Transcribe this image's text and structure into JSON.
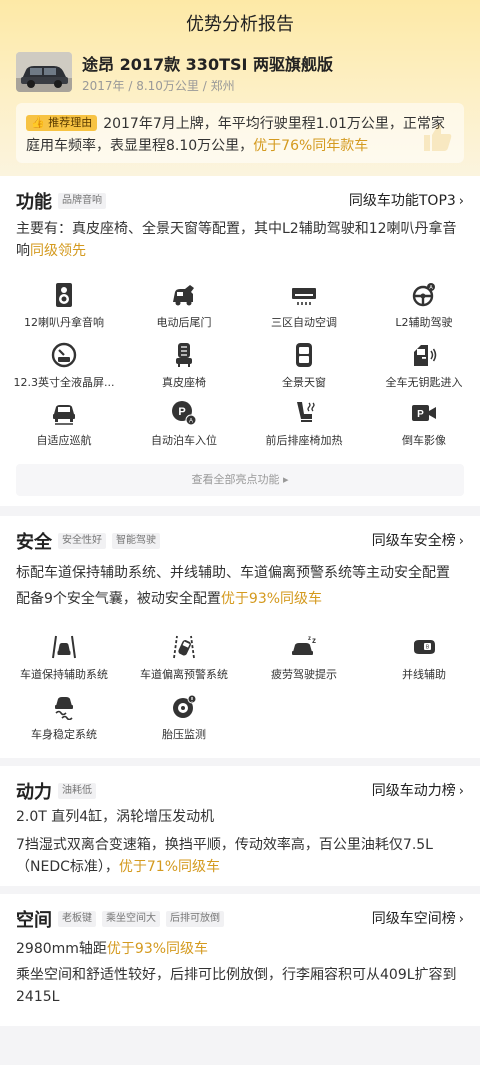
{
  "page_title": "优势分析报告",
  "car": {
    "name": "途昂 2017款 330TSI 两驱旗舰版",
    "meta": "2017年 / 8.10万公里 / 郑州"
  },
  "reason": {
    "badge": "推荐理由",
    "text": "2017年7月上牌，年平均行驶里程1.01万公里，正常家庭用车频率，表显里程8.10万公里，",
    "highlight": "优于76%同年款车"
  },
  "features": {
    "title": "功能",
    "tags": [
      "品牌音响"
    ],
    "link": "同级车功能TOP3",
    "desc_prefix": "主要有：真皮座椅、全景天窗等配置，其中L2辅助驾驶和12喇叭丹拿音响",
    "desc_highlight": "同级领先",
    "items": [
      {
        "label": "12喇叭丹拿音响",
        "icon": "speaker-icon"
      },
      {
        "label": "电动后尾门",
        "icon": "tailgate-icon"
      },
      {
        "label": "三区自动空调",
        "icon": "air-conditioner-icon"
      },
      {
        "label": "L2辅助驾驶",
        "icon": "steering-wheel-icon"
      },
      {
        "label": "12.3英寸全液晶屏...",
        "icon": "lcd-gauge-icon"
      },
      {
        "label": "真皮座椅",
        "icon": "leather-seat-icon"
      },
      {
        "label": "全景天窗",
        "icon": "sunroof-icon"
      },
      {
        "label": "全车无钥匙进入",
        "icon": "keyless-door-icon"
      },
      {
        "label": "自适应巡航",
        "icon": "cruise-car-icon"
      },
      {
        "label": "自动泊车入位",
        "icon": "auto-park-icon"
      },
      {
        "label": "前后排座椅加热",
        "icon": "heated-seat-icon"
      },
      {
        "label": "倒车影像",
        "icon": "reverse-camera-icon"
      }
    ],
    "view_all": "查看全部亮点功能"
  },
  "safety": {
    "title": "安全",
    "tags": [
      "安全性好",
      "智能驾驶"
    ],
    "link": "同级车安全榜",
    "line1": "标配车道保持辅助系统、并线辅助、车道偏离预警系统等主动安全配置",
    "line2_prefix": "配备9个安全气囊，被动安全配置",
    "line2_highlight": "优于93%同级车",
    "items": [
      {
        "label": "车道保持辅助系统",
        "icon": "lane-keep-icon"
      },
      {
        "label": "车道偏离预警系统",
        "icon": "lane-departure-icon"
      },
      {
        "label": "疲劳驾驶提示",
        "icon": "fatigue-car-icon"
      },
      {
        "label": "并线辅助",
        "icon": "blind-spot-mirror-icon"
      },
      {
        "label": "车身稳定系统",
        "icon": "stability-control-icon"
      },
      {
        "label": "胎压监测",
        "icon": "tire-pressure-icon"
      }
    ]
  },
  "power": {
    "title": "动力",
    "tags": [
      "油耗低"
    ],
    "link": "同级车动力榜",
    "line1": "2.0T 直列4缸，涡轮增压发动机",
    "line2_prefix": "7挡湿式双离合变速箱，换挡平顺，传动效率高，百公里油耗仅7.5L（NEDC标准），",
    "line2_highlight": "优于71%同级车"
  },
  "space": {
    "title": "空间",
    "tags": [
      "老板键",
      "乘坐空间大",
      "后排可放倒"
    ],
    "link": "同级车空间榜",
    "line1_prefix": "2980mm轴距",
    "line1_highlight": "优于93%同级车",
    "line2": "乘坐空间和舒适性较好，后排可比例放倒，行李厢容积可从409L扩容到2415L"
  },
  "colors": {
    "accent": "#d49a1f",
    "badge": "#f7c343",
    "header_top": "#fde9a6"
  }
}
